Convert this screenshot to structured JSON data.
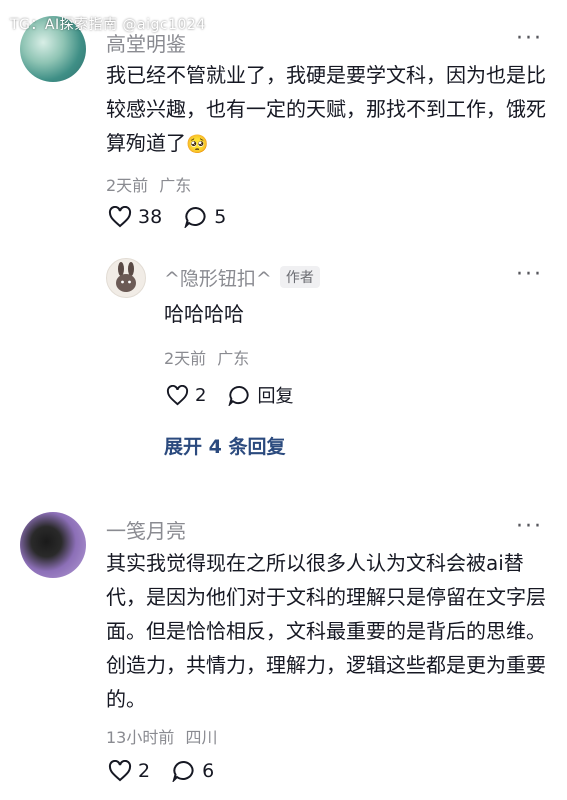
{
  "watermark": "TG：AI探索指南 @aigc1024",
  "comments": [
    {
      "author": "高堂明鉴",
      "text": "我已经不管就业了，我硬是要学文科，因为也是比较感兴趣，也有一定的天赋，那找不到工作，饿死算殉道了",
      "emoji": "🥺",
      "time": "2天前",
      "location": "广东",
      "likes": "38",
      "replies": "5"
    },
    {
      "author": "一笺月亮",
      "text": "其实我觉得现在之所以很多人认为文科会被ai替代，是因为他们对于文科的理解只是停留在文字层面。但是恰恰相反，文科最重要的是背后的思维。创造力，共情力，理解力，逻辑这些都是更为重要的。",
      "time": "13小时前",
      "location": "四川",
      "likes": "2",
      "replies": "6"
    }
  ],
  "reply": {
    "author": "^隐形钮扣^",
    "badge": "作者",
    "text": "哈哈哈哈",
    "time": "2天前",
    "location": "广东",
    "likes": "2",
    "reply_label": "回复"
  },
  "expand_label": "展开 4 条回复",
  "more_glyph": "···"
}
